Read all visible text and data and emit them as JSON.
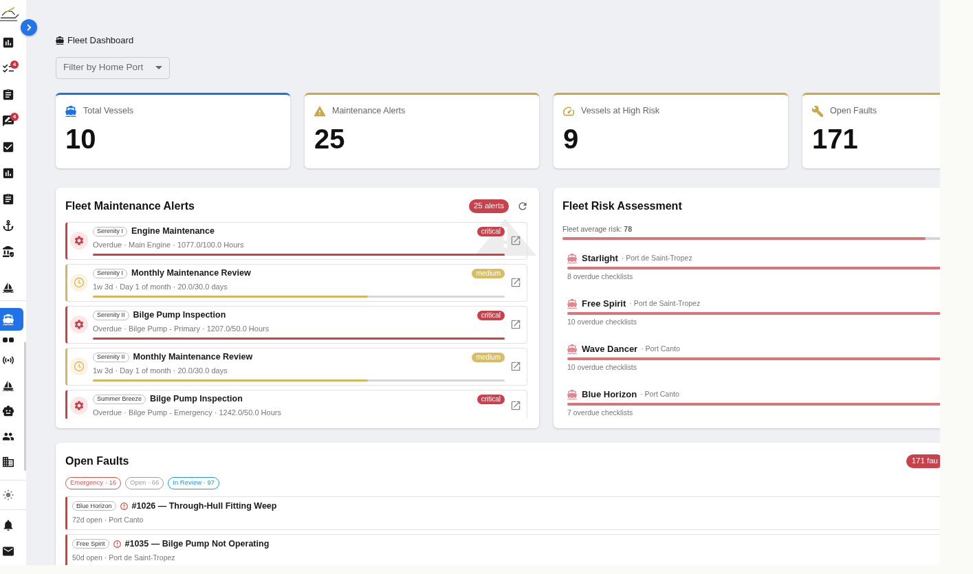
{
  "sidebar": {
    "groups": [
      {
        "items": [
          {
            "selected": false
          },
          {
            "selected": false,
            "badge": "4"
          },
          {
            "selected": false
          },
          {
            "selected": false,
            "badge": "4"
          },
          {
            "selected": false
          },
          {
            "selected": false
          },
          {
            "selected": false
          },
          {
            "selected": false
          },
          {
            "selected": false
          },
          {
            "selected": false
          }
        ]
      },
      {
        "items": [
          {
            "selected": true
          },
          {
            "selected": false
          },
          {
            "selected": false
          },
          {
            "selected": false
          },
          {
            "selected": false
          },
          {
            "selected": false
          },
          {
            "selected": false
          }
        ]
      },
      {
        "items": [
          {
            "selected": false
          }
        ]
      },
      {
        "items": [
          {
            "selected": false
          },
          {
            "selected": false
          }
        ]
      }
    ]
  },
  "page_title": "Fleet Dashboard",
  "home_port_filter": {
    "placeholder": "Filter by Home Port"
  },
  "stat_cards": [
    {
      "label": "Total Vessels",
      "value": "10",
      "color": "#1a73e8"
    },
    {
      "label": "Maintenance Alerts",
      "value": "25",
      "color": "#c9a84c"
    },
    {
      "label": "Vessels at High Risk",
      "value": "9",
      "color": "#c9a84c"
    },
    {
      "label": "Open Faults",
      "value": "171",
      "color": "#c9a84c"
    }
  ],
  "maintenance_alerts": {
    "title": "Fleet Maintenance Alerts",
    "count": "25 alerts",
    "alerts": [
      {
        "kind": "overdue",
        "vessel": "Serenity I",
        "title": "Engine Maintenance",
        "severity": "critical",
        "detail": "Overdue · Main Engine · 1077.0/100.0 Hours",
        "level": 1
      },
      {
        "kind": "upcoming",
        "vessel": "Serenity I",
        "title": "Monthly Maintenance Review",
        "severity": "medium",
        "detail": "1w 3d · Day 1 of month · 20.0/30.0 days",
        "level": 0.667
      },
      {
        "kind": "overdue",
        "vessel": "Serenity II",
        "title": "Bilge Pump Inspection",
        "severity": "critical",
        "detail": "Overdue · Bilge Pump - Primary · 1207.0/50.0 Hours",
        "level": 1
      },
      {
        "kind": "upcoming",
        "vessel": "Serenity II",
        "title": "Monthly Maintenance Review",
        "severity": "medium",
        "detail": "1w 3d · Day 1 of month · 20.0/30.0 days",
        "level": 0.667
      },
      {
        "kind": "overdue",
        "vessel": "Summer Breeze",
        "title": "Bilge Pump Inspection",
        "severity": "critical",
        "detail": "Overdue · Bilge Pump - Emergency · 1242.0/50.0 Hours"
      }
    ]
  },
  "risk_assessment": {
    "title": "Fleet Risk Assessment",
    "average": {
      "text": "Fleet average risk: **78**",
      "level": 0.78
    },
    "vessels": [
      {
        "name": "Starlight",
        "port": "· Port de Saint-Tropez",
        "level": 1,
        "detail": "8 overdue checklists"
      },
      {
        "name": "Free Spirit",
        "port": "· Port de Saint-Tropez",
        "level": 1,
        "detail": "10 overdue checklists"
      },
      {
        "name": "Wave Dancer",
        "port": "· Port Canto",
        "level": 1,
        "detail": "10 overdue checklists"
      },
      {
        "name": "Blue Horizon",
        "port": "· Port Canto",
        "level": 1,
        "detail": "7 overdue checklists"
      }
    ]
  },
  "open_faults": {
    "title": "Open Faults",
    "count": "171 fau",
    "filters": [
      {
        "label": "Emergency · 16",
        "color": "#e5534b"
      },
      {
        "label": "Open · 66",
        "color": "#9e9e9e"
      },
      {
        "label": "In Review · 97",
        "color": "#2196f3"
      }
    ],
    "faults": [
      {
        "vessel": "Blue Horizon",
        "title": "#1026 — Through-Hull Fitting Weep",
        "detail": "72d open · Port Canto"
      },
      {
        "vessel": "Free Spirit",
        "title": "#1035 — Bilge Pump Not Operating",
        "detail": "50d open · Port de Saint-Tropez"
      }
    ]
  }
}
